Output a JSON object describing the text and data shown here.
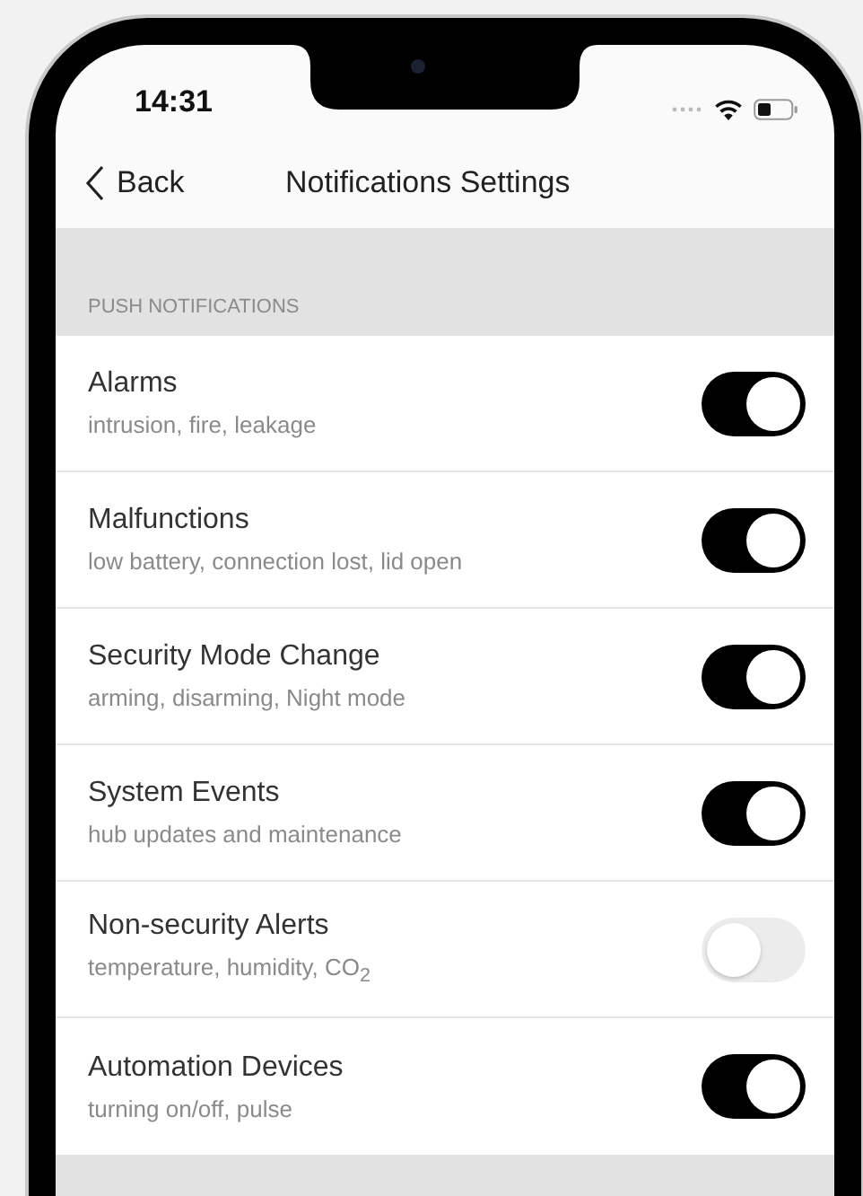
{
  "status_bar": {
    "time": "14:31"
  },
  "nav": {
    "back": "Back",
    "title": "Notifications Settings"
  },
  "section": {
    "header": "PUSH NOTIFICATIONS",
    "items": [
      {
        "title": "Alarms",
        "subtitle": "intrusion, fire, leakage",
        "on": true
      },
      {
        "title": "Malfunctions",
        "subtitle": "low battery, connection lost, lid open",
        "on": true
      },
      {
        "title": "Security Mode Change",
        "subtitle": "arming, disarming, Night mode",
        "on": true
      },
      {
        "title": "System Events",
        "subtitle": "hub updates and maintenance",
        "on": true
      },
      {
        "title": "Non-security Alerts",
        "subtitle": "temperature, humidity, CO$_{2}$",
        "on": false
      },
      {
        "title": "Automation Devices",
        "subtitle": "turning on/off, pulse",
        "on": true
      }
    ]
  }
}
